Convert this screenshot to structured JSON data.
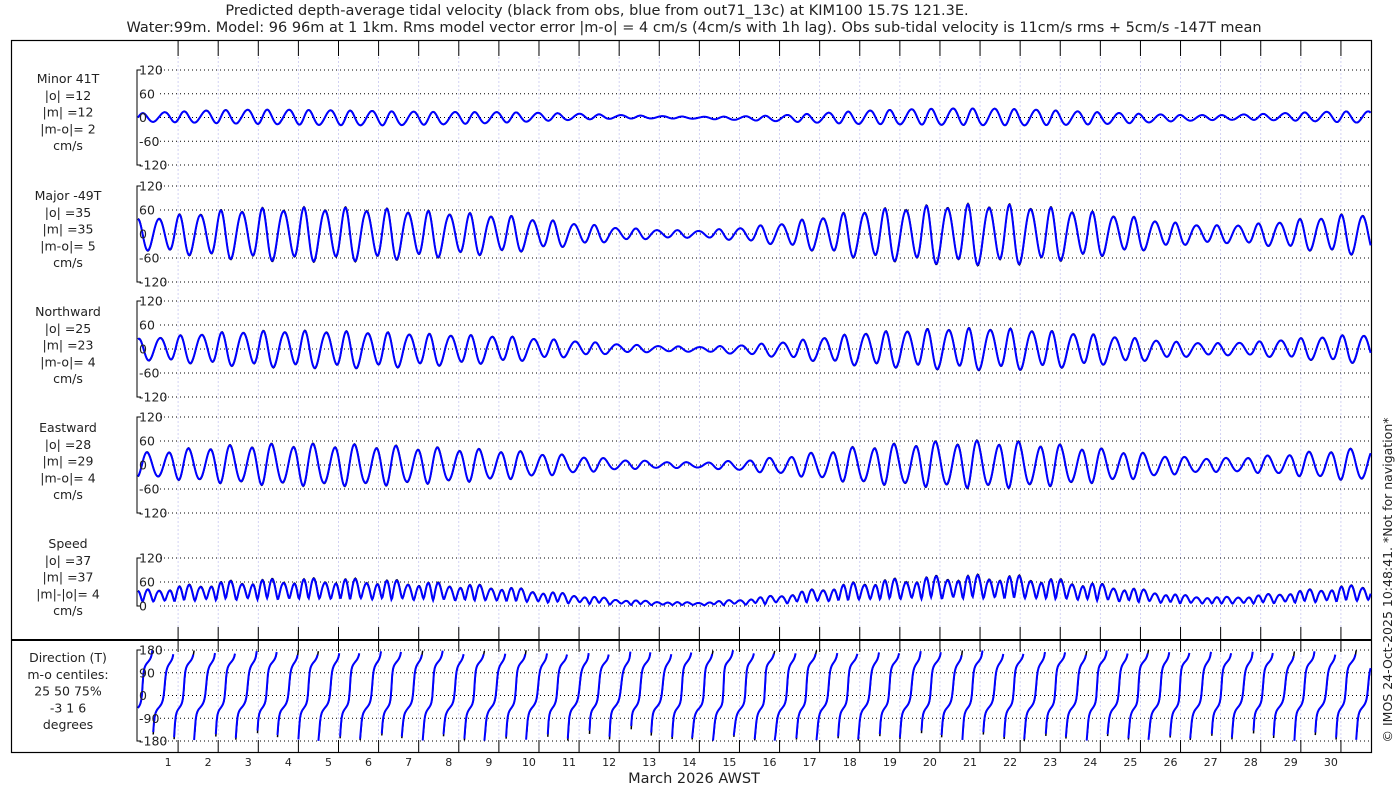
{
  "chart_data": {
    "type": "line",
    "title_lines": [
      "Predicted depth-average tidal velocity (black from obs, blue from out71_13c) at KIM100 15.7S 121.3E.",
      "Water:99m. Model: 96 96m at 1 1km. Rms model vector error |m-o| = 4 cm/s (4cm/s with 1h lag). Obs sub-tidal velocity is 11cm/s rms + 5cm/s -147T mean"
    ],
    "xlabel": "March 2026 AWST",
    "x_tick_labels": [
      "1",
      "2",
      "3",
      "4",
      "5",
      "6",
      "7",
      "8",
      "9",
      "10",
      "11",
      "12",
      "13",
      "14",
      "15",
      "16",
      "17",
      "18",
      "19",
      "20",
      "21",
      "22",
      "23",
      "24",
      "25",
      "26",
      "27",
      "28",
      "29",
      "30"
    ],
    "xlim_days": [
      0,
      30.75
    ],
    "credit": "© IMOS 24-Oct-2025 10:48:41. *Not for navigation*",
    "series_legend": {
      "obs": "black",
      "model": "blue"
    },
    "colors": {
      "obs": "#000000",
      "model": "#0000ff",
      "grid": "#000000",
      "daygrid": "#c8c8f0"
    },
    "tidal_period_days": 0.5175,
    "major_axis_deg_true": -49,
    "minor_axis_deg_true": 41,
    "minor_to_major_ratio": 0.3,
    "major_amplitude_envelope_cm_s": [
      35,
      45,
      55,
      60,
      62,
      62,
      60,
      55,
      50,
      45,
      35,
      25,
      15,
      10,
      8,
      15,
      25,
      40,
      55,
      62,
      68,
      70,
      68,
      60,
      50,
      38,
      25,
      20,
      25,
      35,
      45,
      50
    ],
    "panels": [
      {
        "id": "minor",
        "label": [
          "Minor 41T",
          "|o| =12",
          "|m| =12",
          "|m-o|= 2",
          "cm/s"
        ],
        "ylim": [
          -120,
          120
        ],
        "yticks": [
          "120",
          "60",
          "0",
          "-60",
          "-120"
        ],
        "ytick_values": [
          120,
          60,
          0,
          -60,
          -120
        ]
      },
      {
        "id": "major",
        "label": [
          "Major -49T",
          "|o| =35",
          "|m| =35",
          "|m-o|= 5",
          "cm/s"
        ],
        "ylim": [
          -120,
          120
        ],
        "yticks": [
          "120",
          "60",
          "0",
          "-60",
          "-120"
        ],
        "ytick_values": [
          120,
          60,
          0,
          -60,
          -120
        ]
      },
      {
        "id": "north",
        "label": [
          "Northward",
          "|o| =25",
          "|m| =23",
          "|m-o|= 4",
          "cm/s"
        ],
        "ylim": [
          -120,
          120
        ],
        "yticks": [
          "120",
          "60",
          "0",
          "-60",
          "-120"
        ],
        "ytick_values": [
          120,
          60,
          0,
          -60,
          -120
        ]
      },
      {
        "id": "east",
        "label": [
          "Eastward",
          "|o| =28",
          "|m| =29",
          "|m-o|= 4",
          "cm/s"
        ],
        "ylim": [
          -120,
          120
        ],
        "yticks": [
          "120",
          "60",
          "0",
          "-60",
          "-120"
        ],
        "ytick_values": [
          120,
          60,
          0,
          -60,
          -120
        ]
      },
      {
        "id": "speed",
        "label": [
          "Speed",
          "|o| =37",
          "|m| =37",
          "|m|-|o|= 4",
          "cm/s"
        ],
        "ylim": [
          0,
          120
        ],
        "yticks": [
          "120",
          "60",
          "0"
        ],
        "ytick_values": [
          120,
          60,
          0
        ]
      },
      {
        "id": "direction",
        "label": [
          "Direction (T)",
          "m-o centiles:",
          "25  50  75%",
          "-3  1  6",
          "degrees"
        ],
        "ylim": [
          -180,
          180
        ],
        "yticks": [
          "180",
          "90",
          "0",
          "-90",
          "-180"
        ],
        "ytick_values": [
          180,
          90,
          0,
          -90,
          -180
        ]
      }
    ]
  }
}
